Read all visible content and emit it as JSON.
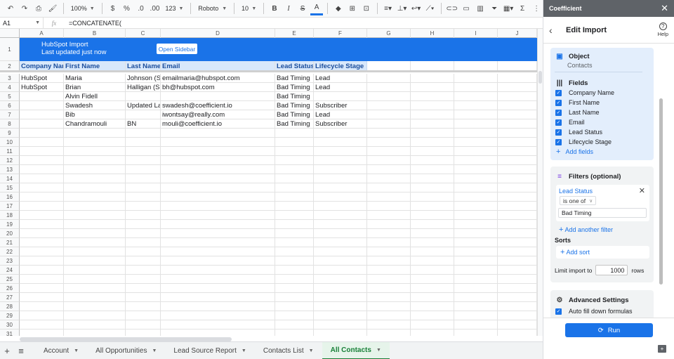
{
  "toolbar": {
    "zoom": "100%",
    "currency": "$",
    "percent": "%",
    "dec_decrease": ".0",
    "dec_increase": ".00",
    "format_more": "123",
    "font": "Roboto",
    "font_size": "10",
    "bold": "B",
    "italic": "I",
    "strike": "S",
    "text_color": "A",
    "functions": "Σ"
  },
  "formula_bar": {
    "cell_ref": "A1",
    "fx": "fx",
    "value": "=CONCATENATE("
  },
  "columns": [
    {
      "letter": "A",
      "w": 63
    },
    {
      "letter": "B",
      "w": 88
    },
    {
      "letter": "C",
      "w": 50
    },
    {
      "letter": "D",
      "w": 163
    },
    {
      "letter": "E",
      "w": 55
    },
    {
      "letter": "F",
      "w": 76
    },
    {
      "letter": "G",
      "w": 62
    },
    {
      "letter": "H",
      "w": 62
    },
    {
      "letter": "I",
      "w": 62
    },
    {
      "letter": "J",
      "w": 56
    }
  ],
  "banner": {
    "line1": "HubSpot Import",
    "line2": "Last updated just now",
    "button": "Open Sidebar"
  },
  "header_row": [
    "Company Name",
    "First Name",
    "Last Name",
    "Email",
    "Lead Status",
    "Lifecycle Stage"
  ],
  "data_rows": [
    [
      "HubSpot",
      "Maria",
      "Johnson (Sample Contact)",
      "emailmaria@hubspot.com",
      "Bad Timing",
      "Lead"
    ],
    [
      "HubSpot",
      "Brian",
      "Halligan (Sample Contact)",
      "bh@hubspot.com",
      "Bad Timing",
      "Lead"
    ],
    [
      "",
      "Alvin Fidell",
      "",
      "",
      "Bad Timing",
      ""
    ],
    [
      "",
      "Swadesh",
      "Updated Last Name",
      "swadesh@coefficient.io",
      "Bad Timing",
      "Subscriber"
    ],
    [
      "",
      "Bib",
      "",
      "iwontsay@really.com",
      "Bad Timing",
      "Lead"
    ],
    [
      "",
      "Chandramouli",
      "BN",
      "mouli@coefficient.io",
      "Bad Timing",
      "Subscriber"
    ]
  ],
  "row_numbers": [
    "1",
    "2",
    "3",
    "4",
    "5",
    "6",
    "7",
    "8",
    "9",
    "10",
    "11",
    "12",
    "13",
    "14",
    "15",
    "16",
    "17",
    "18",
    "19",
    "20",
    "21",
    "22",
    "23",
    "24",
    "25",
    "26",
    "27",
    "28",
    "29",
    "30",
    "31"
  ],
  "sheet_tabs": [
    {
      "label": "Account",
      "active": false
    },
    {
      "label": "All Opportunities",
      "active": false
    },
    {
      "label": "Lead Source Report",
      "active": false
    },
    {
      "label": "Contacts List",
      "active": false
    },
    {
      "label": "All Contacts",
      "active": true
    }
  ],
  "sidebar": {
    "app_name": "Coefficient",
    "title": "Edit Import",
    "help": "Help",
    "object_title": "Object",
    "object_value": "Contacts",
    "fields_title": "Fields",
    "fields": [
      "Company Name",
      "First Name",
      "Last Name",
      "Email",
      "Lead Status",
      "Lifecycle Stage"
    ],
    "add_fields": "Add fields",
    "filters_title": "Filters (optional)",
    "filter": {
      "field": "Lead Status",
      "operator": "is one of",
      "value": "Bad Timing"
    },
    "add_filter": "Add another filter",
    "sorts_title": "Sorts",
    "add_sort": "Add sort",
    "limit_label": "Limit import to",
    "limit_value": "1000",
    "limit_unit": "rows",
    "advanced_title": "Advanced Settings",
    "autofill": "Auto fill down formulas",
    "run": "Run"
  },
  "colors": {
    "accent": "#1a73e8",
    "header_fill": "#d8e8fb",
    "active_tab": "#188038"
  }
}
